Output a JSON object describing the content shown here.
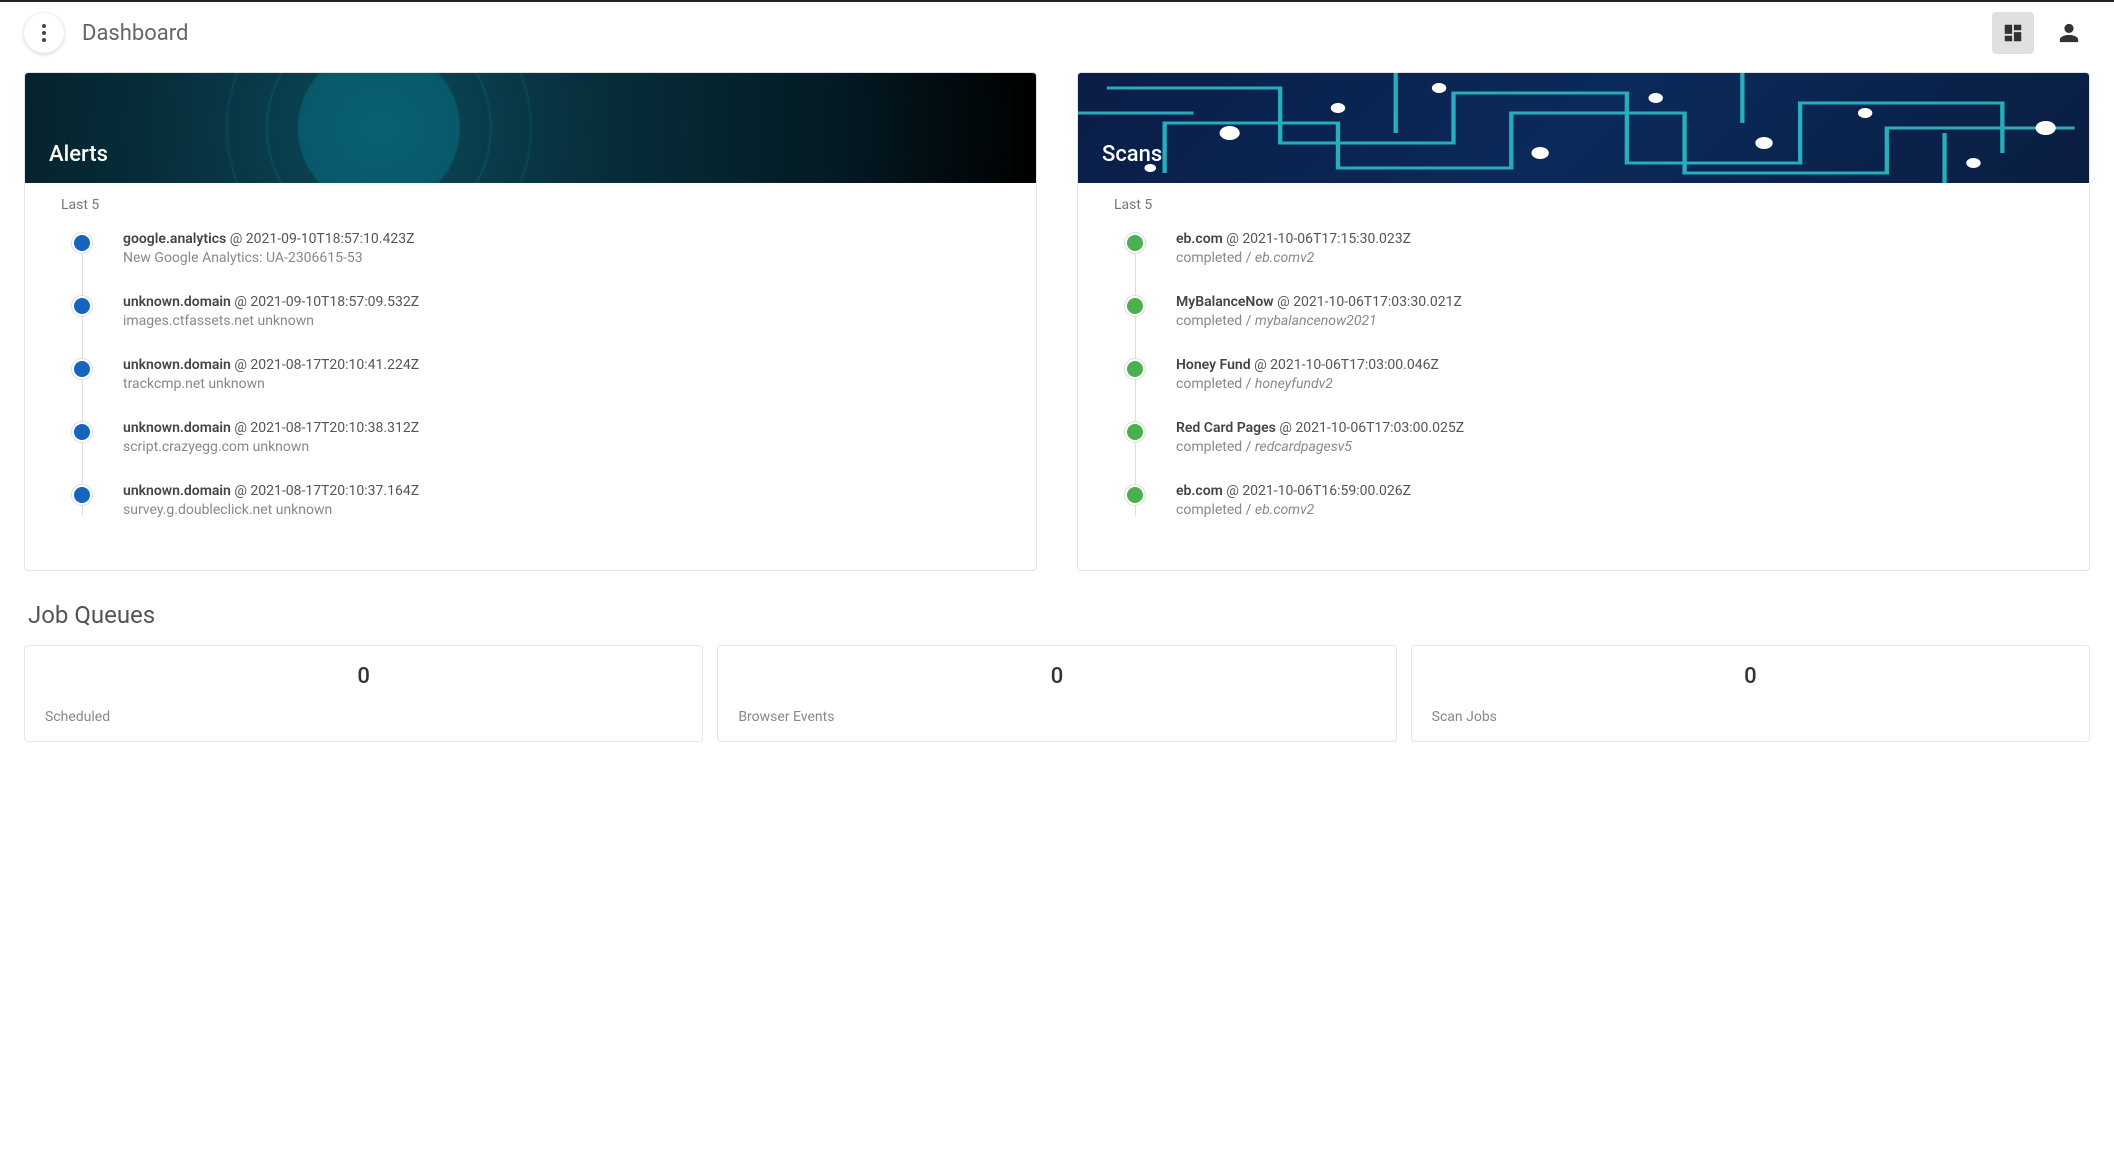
{
  "header": {
    "title": "Dashboard"
  },
  "alerts": {
    "title": "Alerts",
    "subhead": "Last 5",
    "items": [
      {
        "name": "google.analytics",
        "ts": "2021-09-10T18:57:10.423Z",
        "detail": "New Google Analytics: UA-2306615-53",
        "color": "blue"
      },
      {
        "name": "unknown.domain",
        "ts": "2021-09-10T18:57:09.532Z",
        "detail": "images.ctfassets.net unknown",
        "color": "blue"
      },
      {
        "name": "unknown.domain",
        "ts": "2021-08-17T20:10:41.224Z",
        "detail": "trackcmp.net unknown",
        "color": "blue"
      },
      {
        "name": "unknown.domain",
        "ts": "2021-08-17T20:10:38.312Z",
        "detail": "script.crazyegg.com unknown",
        "color": "blue"
      },
      {
        "name": "unknown.domain",
        "ts": "2021-08-17T20:10:37.164Z",
        "detail": "survey.g.doubleclick.net unknown",
        "color": "blue"
      }
    ]
  },
  "scans": {
    "title": "Scans",
    "subhead": "Last 5",
    "items": [
      {
        "name": "eb.com",
        "ts": "2021-10-06T17:15:30.023Z",
        "status": "completed",
        "slug": "eb.comv2",
        "color": "green"
      },
      {
        "name": "MyBalanceNow",
        "ts": "2021-10-06T17:03:30.021Z",
        "status": "completed",
        "slug": "mybalancenow2021",
        "color": "green"
      },
      {
        "name": "Honey Fund",
        "ts": "2021-10-06T17:03:00.046Z",
        "status": "completed",
        "slug": "honeyfundv2",
        "color": "green"
      },
      {
        "name": "Red Card Pages",
        "ts": "2021-10-06T17:03:00.025Z",
        "status": "completed",
        "slug": "redcardpagesv5",
        "color": "green"
      },
      {
        "name": "eb.com",
        "ts": "2021-10-06T16:59:00.026Z",
        "status": "completed",
        "slug": "eb.comv2",
        "color": "green"
      }
    ]
  },
  "queues": {
    "title": "Job Queues",
    "items": [
      {
        "count": "0",
        "label": "Scheduled"
      },
      {
        "count": "0",
        "label": "Browser Events"
      },
      {
        "count": "0",
        "label": "Scan Jobs"
      }
    ]
  },
  "sep": {
    "at": " @ ",
    "slash": " / "
  }
}
